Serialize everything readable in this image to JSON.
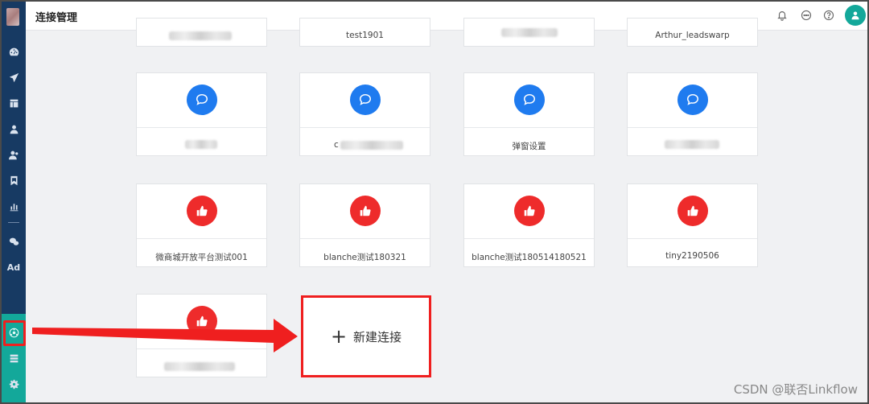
{
  "header": {
    "title": "连接管理"
  },
  "sidebar": {
    "items": [
      {
        "icon": "dashboard-icon"
      },
      {
        "icon": "send-icon"
      },
      {
        "icon": "layout-icon"
      },
      {
        "icon": "user-icon"
      },
      {
        "icon": "users-icon"
      },
      {
        "icon": "bookmark-icon"
      },
      {
        "icon": "bar-chart-icon"
      },
      {
        "icon": "wechat-icon"
      },
      {
        "icon": "ad-icon",
        "text": "Ad"
      },
      {
        "icon": "connection-hub-icon"
      },
      {
        "icon": "server-icon"
      },
      {
        "icon": "gear-icon"
      }
    ]
  },
  "top_row": [
    {
      "label": ""
    },
    {
      "label": "test1901"
    },
    {
      "label": ""
    },
    {
      "label": "Arthur_leadswarp"
    }
  ],
  "row2": [
    {
      "label": ""
    },
    {
      "label": "c"
    },
    {
      "label": "弹窗设置"
    },
    {
      "label": ""
    }
  ],
  "row3": [
    {
      "label": "微商城开放平台测试001"
    },
    {
      "label": "blanche测试180321"
    },
    {
      "label": "blanche测试180514180521"
    },
    {
      "label": "tiny2190506"
    }
  ],
  "row4": [
    {
      "label": ""
    }
  ],
  "new_connection": {
    "plus": "+",
    "label": "新建连接"
  },
  "watermark": "CSDN @联否Linkflow",
  "colors": {
    "sidebar": "#173a63",
    "teal": "#13a89a",
    "blue": "#1f7bef",
    "red": "#ee2b2b",
    "highlight": "#ef1f1f"
  }
}
